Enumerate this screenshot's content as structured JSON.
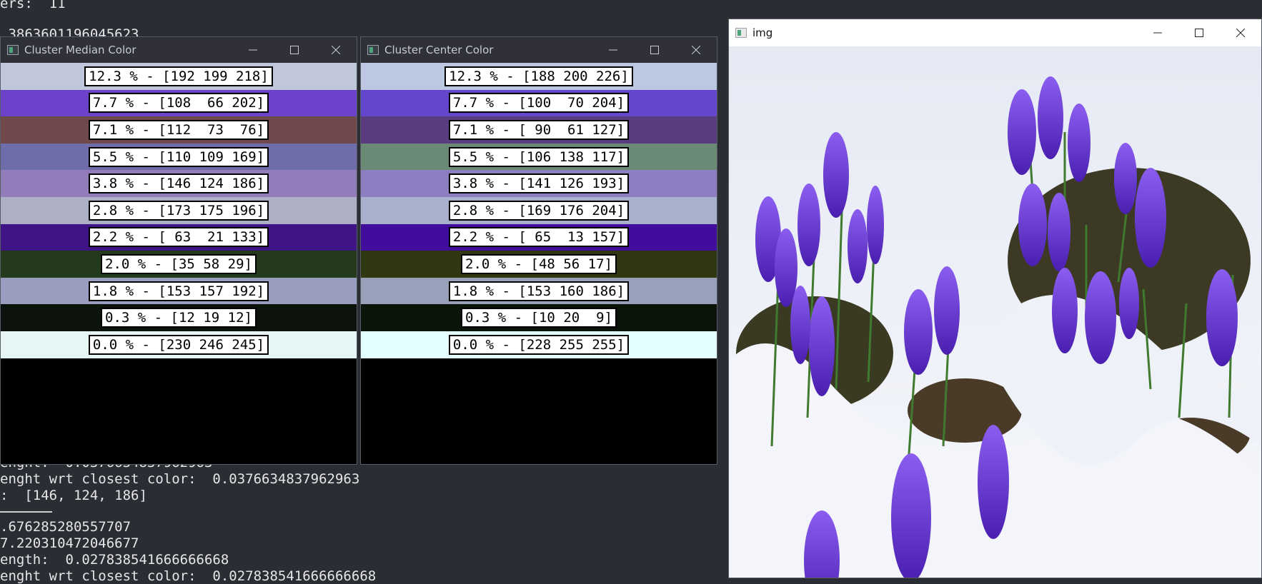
{
  "terminal": {
    "lines_top": [
      "ers:  11",
      ".3863601196045623"
    ],
    "lines_bottom": [
      "enght:  0.0376634837962963",
      "enght wrt closest color:  0.0376634837962963",
      ":  [146, 124, 186]",
      ".676285280557707",
      "7.220310472046677",
      "ength:  0.027838541666666668",
      "enght wrt closest color:  0.027838541666666668"
    ]
  },
  "median_window": {
    "title": "Cluster Median Color",
    "rows": [
      {
        "label": "12.3 % - [192 199 218]",
        "color": "#c0c7da"
      },
      {
        "label": "7.7 % - [108  66 202]",
        "color": "#6c42ca"
      },
      {
        "label": "7.1 % - [112  73  76]",
        "color": "#70494c"
      },
      {
        "label": "5.5 % - [110 109 169]",
        "color": "#6e6da9"
      },
      {
        "label": "3.8 % - [146 124 186]",
        "color": "#927cba"
      },
      {
        "label": "2.8 % - [173 175 196]",
        "color": "#adafc4"
      },
      {
        "label": "2.2 % - [ 63  21 133]",
        "color": "#3f1585"
      },
      {
        "label": "2.0 % - [35 58 29]",
        "color": "#233a1d"
      },
      {
        "label": "1.8 % - [153 157 192]",
        "color": "#999dc0"
      },
      {
        "label": "0.3 % - [12 19 12]",
        "color": "#0c130c"
      },
      {
        "label": "0.0 % - [230 246 245]",
        "color": "#e6f6f5"
      }
    ]
  },
  "center_window": {
    "title": "Cluster Center Color",
    "rows": [
      {
        "label": "12.3 % - [188 200 226]",
        "color": "#bcc8e2"
      },
      {
        "label": "7.7 % - [100  70 204]",
        "color": "#6446cc"
      },
      {
        "label": "7.1 % - [ 90  61 127]",
        "color": "#5a3d7f"
      },
      {
        "label": "5.5 % - [106 138 117]",
        "color": "#6a8a75"
      },
      {
        "label": "3.8 % - [141 126 193]",
        "color": "#8d7ec1"
      },
      {
        "label": "2.8 % - [169 176 204]",
        "color": "#a9b0cc"
      },
      {
        "label": "2.2 % - [ 65  13 157]",
        "color": "#410d9d"
      },
      {
        "label": "2.0 % - [48 56 17]",
        "color": "#303811"
      },
      {
        "label": "1.8 % - [153 160 186]",
        "color": "#99a0ba"
      },
      {
        "label": "0.3 % - [10 20  9]",
        "color": "#0a1409"
      },
      {
        "label": "0.0 % - [228 255 255]",
        "color": "#e4ffff"
      }
    ]
  },
  "img_window": {
    "title": "img"
  },
  "icons": {
    "app": "window-app-icon",
    "minimize": "minimize-icon",
    "maximize": "maximize-icon",
    "close": "close-icon"
  }
}
